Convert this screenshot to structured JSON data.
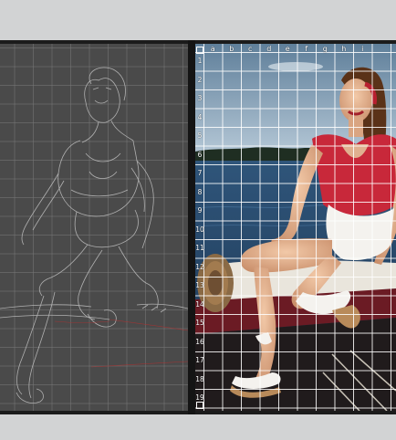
{
  "grid": {
    "columns": [
      "a",
      "b",
      "c",
      "d",
      "e",
      "f",
      "g",
      "h",
      "i"
    ],
    "rows": [
      "1",
      "2",
      "3",
      "4",
      "5",
      "6",
      "7",
      "8",
      "9",
      "10",
      "11",
      "12",
      "13",
      "14",
      "15",
      "16",
      "17",
      "18",
      "19"
    ]
  },
  "colors": {
    "left_panel_bg": "#4a4a4a",
    "sketch_line": "#bdbdbd",
    "sketch_red": "#b03030",
    "dress_red": "#c8283a",
    "sky": "#7d9bb3",
    "water": "#2a4a6a"
  }
}
